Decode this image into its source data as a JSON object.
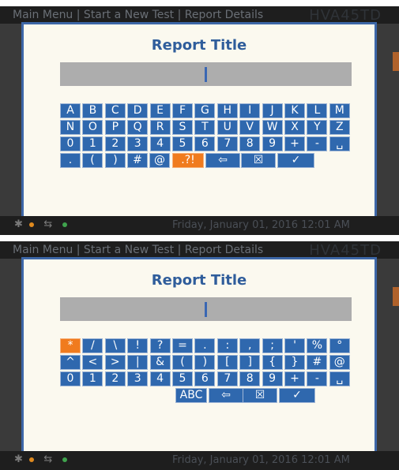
{
  "screens": [
    {
      "breadcrumb": "Main Menu  |  Start a New Test  |  Report Details",
      "model": "HVA45TD",
      "datetime": "Friday, January 01, 2016 12:01 AM",
      "dialog_title": "Report Title",
      "entry_value": "",
      "rows": [
        [
          "A",
          "B",
          "C",
          "D",
          "E",
          "F",
          "G",
          "H",
          "I",
          "J",
          "K",
          "L",
          "M"
        ],
        [
          "N",
          "O",
          "P",
          "Q",
          "R",
          "S",
          "T",
          "U",
          "V",
          "W",
          "X",
          "Y",
          "Z"
        ],
        [
          "0",
          "1",
          "2",
          "3",
          "4",
          "5",
          "6",
          "7",
          "8",
          "9",
          "+",
          "-",
          "␣"
        ],
        [
          ".",
          "(",
          ")",
          "#",
          "@",
          ".?!",
          "⇦",
          "☒",
          "✓"
        ]
      ],
      "active_key": ".?!"
    },
    {
      "breadcrumb": "Main Menu  |  Start a New Test  |  Report Details",
      "model": "HVA45TD",
      "datetime": "Friday, January 01, 2016 12:01 AM",
      "dialog_title": "Report Title",
      "entry_value": "",
      "rows": [
        [
          "*",
          "/",
          "\\",
          "!",
          "?",
          "=",
          ".",
          ":",
          ",",
          ";",
          "'",
          "%",
          "°"
        ],
        [
          "^",
          "<",
          ">",
          "|",
          "&",
          "(",
          ")",
          "[",
          "]",
          "{",
          "}",
          "#",
          "@"
        ],
        [
          "0",
          "1",
          "2",
          "3",
          "4",
          "5",
          "6",
          "7",
          "8",
          "9",
          "+",
          "-",
          "␣"
        ],
        [
          "ABC",
          "⇦",
          "☒",
          "✓"
        ]
      ],
      "active_key": "*"
    }
  ],
  "colors": {
    "accent": "#2f68ae",
    "active": "#f07b1e",
    "dialog_bg": "#fbf9ef",
    "title": "#2f5d9b"
  },
  "icons": {
    "bluetooth": "bluetooth-icon",
    "usb": "usb-icon",
    "backspace": "backspace-icon",
    "cancel": "cancel-icon",
    "confirm": "confirm-icon",
    "space": "space-icon"
  }
}
